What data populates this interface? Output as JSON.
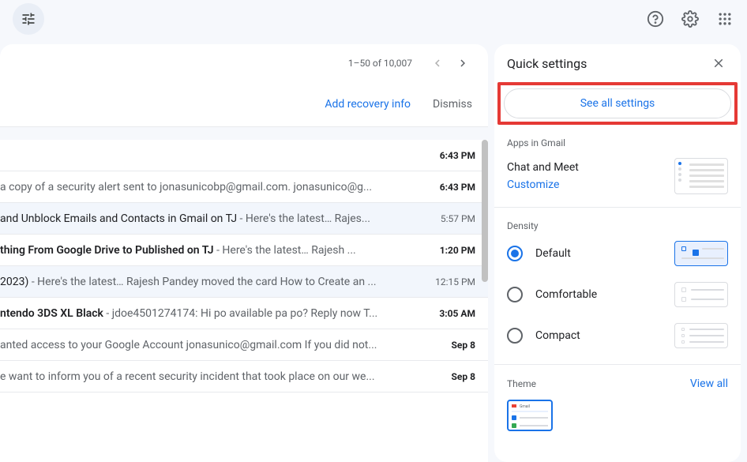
{
  "header": {},
  "toolbar": {
    "pagination": "1–50 of 10,007"
  },
  "banner": {
    "action": "Add recovery info",
    "dismiss": "Dismiss"
  },
  "emails": [
    {
      "subject": "",
      "snippet": "",
      "date": "6:43 PM",
      "unread": true
    },
    {
      "subject": "",
      "snippet": "a copy of a security alert sent to jonasunicobp@gmail.com. jonasunico@g...",
      "date": "6:43 PM",
      "unread": true
    },
    {
      "subject": "and Unblock Emails and Contacts in Gmail on TJ",
      "snippet": " - Here's the latest… Rajes...",
      "date": "5:57 PM",
      "unread": false
    },
    {
      "subject": "thing From Google Drive to Published on TJ",
      "snippet": " - Here's the latest… Rajesh ...",
      "date": "1:20 PM",
      "unread": true
    },
    {
      "subject": "2023)",
      "snippet": " - Here's the latest… Rajesh Pandey moved the card How to Create an ...",
      "date": "12:15 PM",
      "unread": false
    },
    {
      "subject": "ntendo 3DS XL Black",
      "snippet": " - jdoe4501274174: Hi po available pa po? Reply now T...",
      "date": "3:05 AM",
      "unread": true
    },
    {
      "subject": "",
      "snippet": "anted access to your Google Account jonasunico@gmail.com If you did not...",
      "date": "Sep 8",
      "unread": true
    },
    {
      "subject": "",
      "snippet": "e want to inform you of a recent security incident that took place on our we...",
      "date": "Sep 8",
      "unread": true
    }
  ],
  "quick_settings": {
    "title": "Quick settings",
    "see_all": "See all settings",
    "apps_section": "Apps in Gmail",
    "chat_meet": "Chat and Meet",
    "customize": "Customize",
    "density_section": "Density",
    "density": {
      "default": "Default",
      "comfortable": "Comfortable",
      "compact": "Compact"
    },
    "theme_section": "Theme",
    "view_all": "View all"
  }
}
